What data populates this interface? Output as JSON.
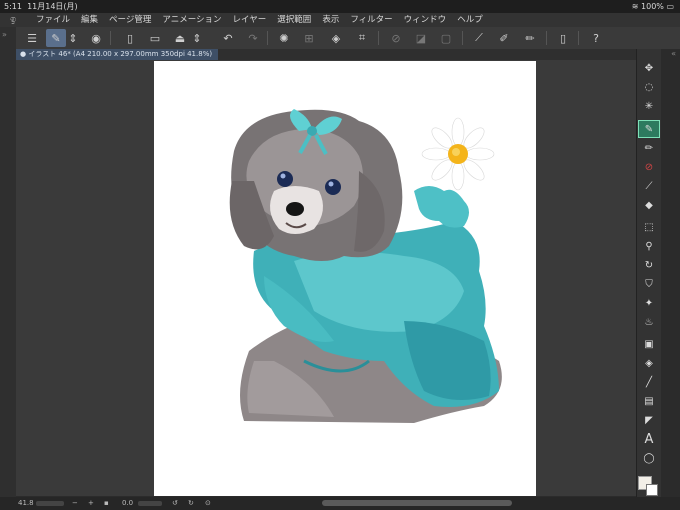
{
  "status": {
    "time": "5:11",
    "date": "11月14日(月)",
    "battery": "100%"
  },
  "menu": [
    "ファイル",
    "編集",
    "ページ管理",
    "アニメーション",
    "レイヤー",
    "選択範囲",
    "表示",
    "フィルター",
    "ウィンドウ",
    "ヘルプ"
  ],
  "document": {
    "tab": "● イラスト 46* (A4 210.00 x 297.00mm 350dpi 41.8%)"
  },
  "bottom": {
    "zoom": "41.8",
    "rotation": "0.0"
  },
  "colors": {
    "accent": "#5a6f8c",
    "active_tool": "#2d7a5f",
    "main_color": "#f2efe8"
  }
}
